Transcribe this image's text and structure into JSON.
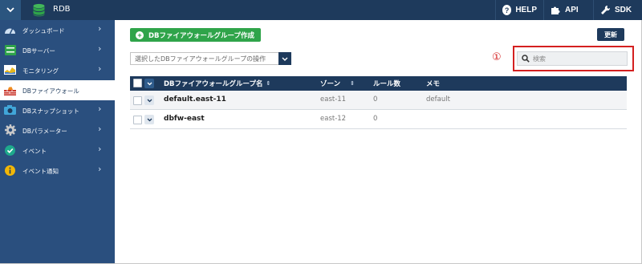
{
  "header": {
    "app_title": "RDB",
    "help_label": "HELP",
    "api_label": "API",
    "sdk_label": "SDK",
    "colors": {
      "bar": "#1e3a5c",
      "menu_button": "#2b557f"
    }
  },
  "sidebar": {
    "items": [
      {
        "label": "ダッシュボード",
        "icon": "dashboard-gauge-icon"
      },
      {
        "label": "DBサーバー",
        "icon": "db-server-icon"
      },
      {
        "label": "モニタリング",
        "icon": "monitoring-chart-icon"
      },
      {
        "label": "DBファイアウォール",
        "icon": "firewall-icon",
        "active": true
      },
      {
        "label": "DBスナップショット",
        "icon": "camera-icon"
      },
      {
        "label": "DBパラメーター",
        "icon": "gear-icon"
      },
      {
        "label": "イベント",
        "icon": "event-check-icon"
      },
      {
        "label": "イベント通知",
        "icon": "info-icon"
      }
    ]
  },
  "main": {
    "create_button_label": "DBファイアウォールグループ作成",
    "refresh_button_label": "更新",
    "action_select_label": "選択したDBファイアウォールグループの操作",
    "annotation_marker": "①",
    "search_placeholder": "検索",
    "table": {
      "columns": [
        "DBファイアウォールグループ名",
        "ゾーン",
        "ルール数",
        "メモ"
      ],
      "rows": [
        {
          "name": "default.east-11",
          "zone": "east-11",
          "rules": "0",
          "memo": "default"
        },
        {
          "name": "dbfw-east",
          "zone": "east-12",
          "rules": "0",
          "memo": ""
        }
      ]
    }
  },
  "colors": {
    "accent_green": "#2fa44a",
    "navy": "#1e3a5c",
    "sidebar": "#2a4f7e",
    "highlight_red": "#d42020"
  }
}
